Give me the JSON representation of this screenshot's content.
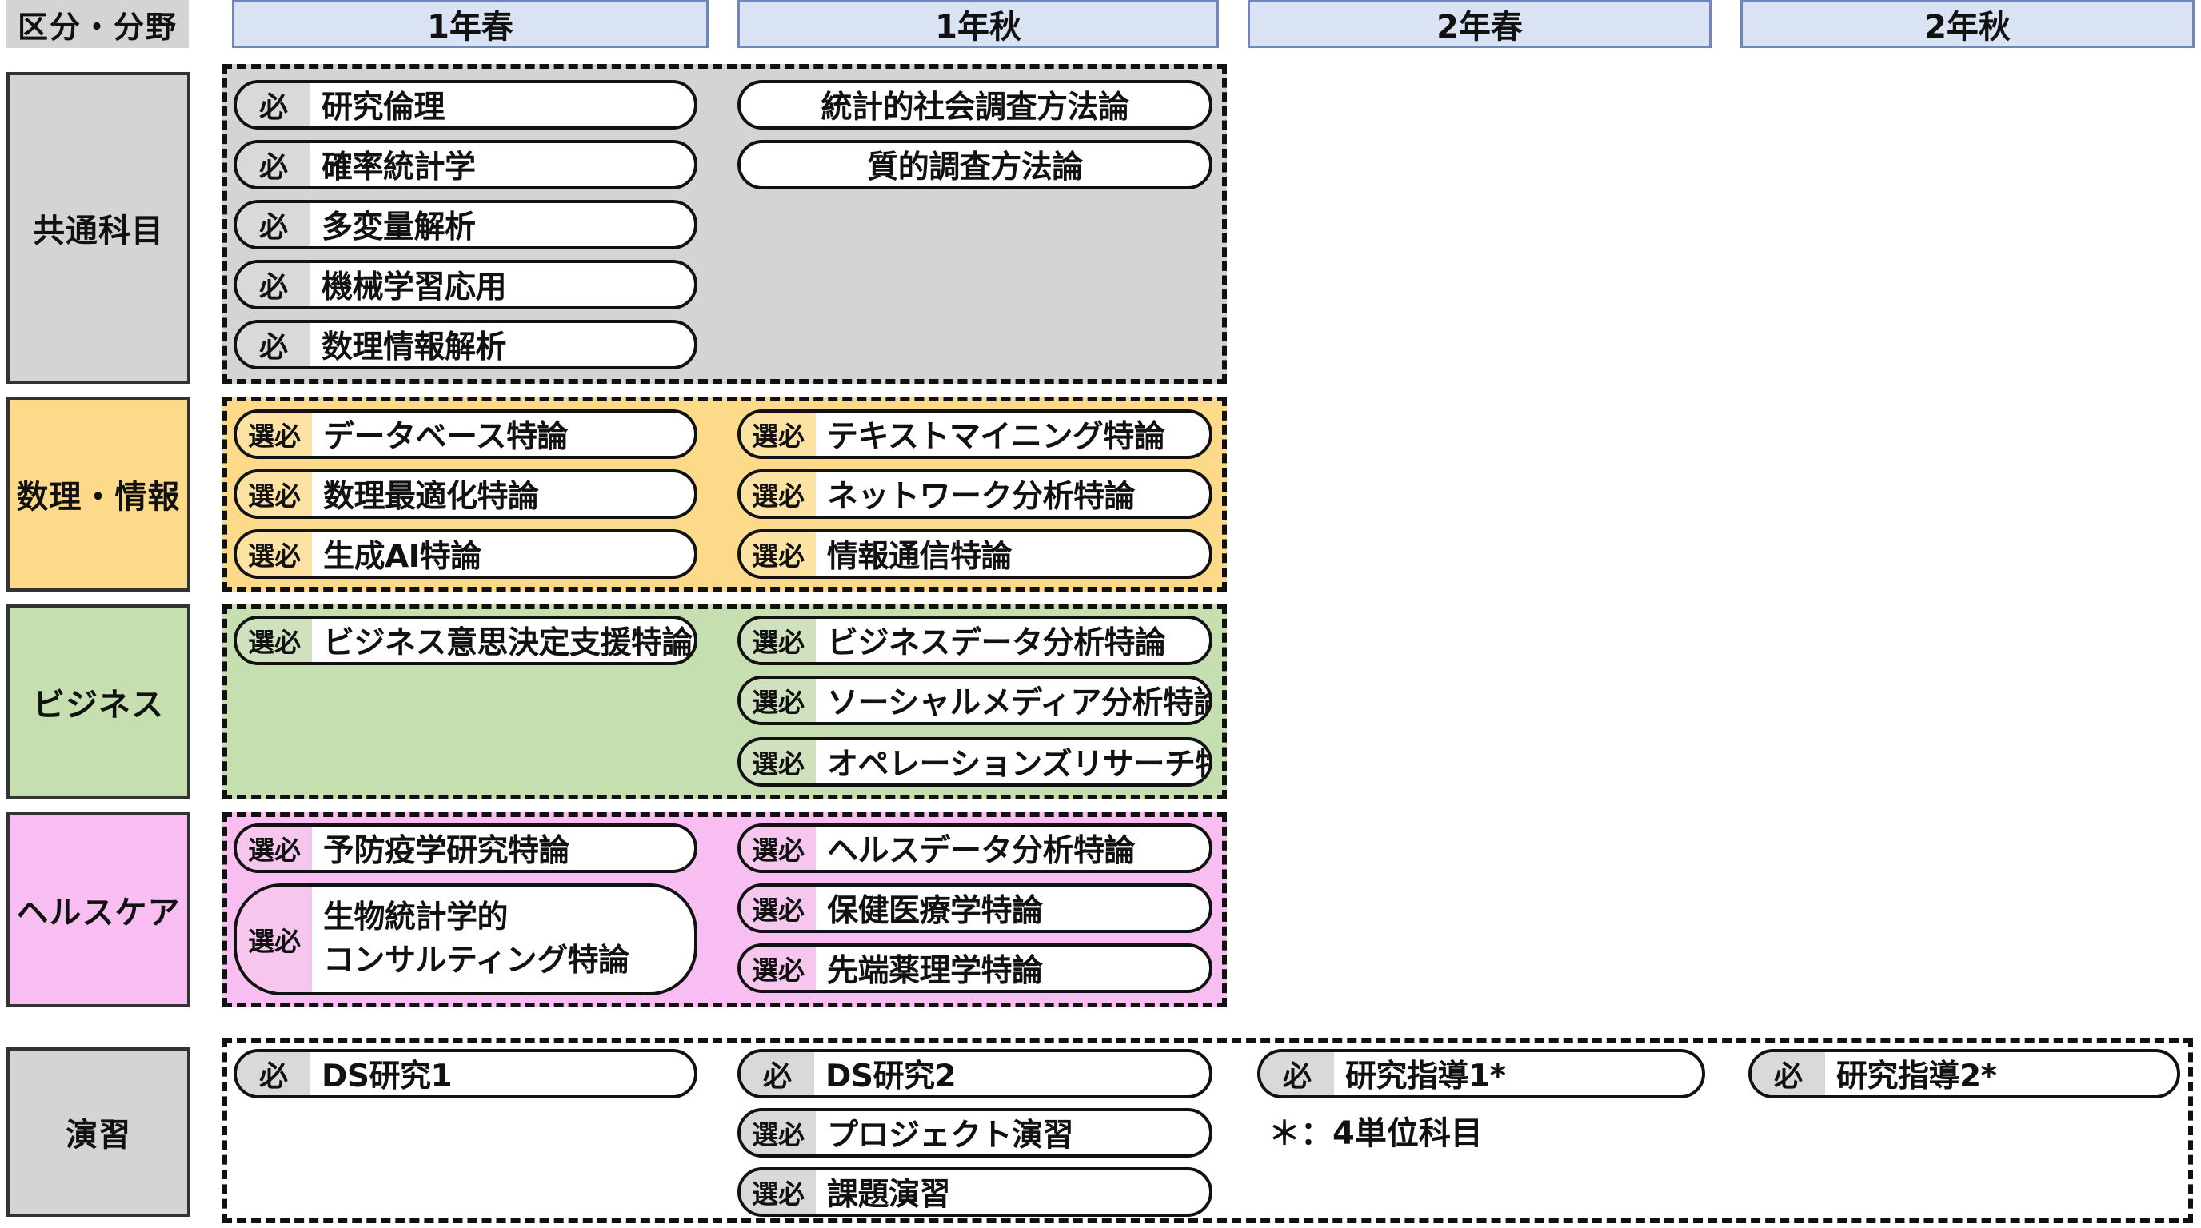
{
  "header": {
    "corner": "区分・分野",
    "columns": [
      "1年春",
      "1年秋",
      "2年春",
      "2年秋"
    ]
  },
  "rows": {
    "common": "共通科目",
    "math": "数理・情報",
    "business": "ビジネス",
    "health": "ヘルスケア",
    "practice": "演習"
  },
  "badges": {
    "required": "必",
    "elective": "選必"
  },
  "colors": {
    "common": "#d4d4d4",
    "math": "#fdd98a",
    "business": "#c6dfb0",
    "health": "#f8bdf1",
    "practice": "#d4d4d4",
    "header": "#dae3f3"
  },
  "courses": {
    "common": {
      "spring1": [
        "研究倫理",
        "確率統計学",
        "多変量解析",
        "機械学習応用",
        "数理情報解析"
      ],
      "autumn1": [
        "統計的社会調査方法論",
        "質的調査方法論"
      ]
    },
    "math": {
      "spring1": [
        "データベース特論",
        "数理最適化特論",
        "生成AI特論"
      ],
      "autumn1": [
        "テキストマイニング特論",
        "ネットワーク分析特論",
        "情報通信特論"
      ]
    },
    "business": {
      "spring1": [
        "ビジネス意思決定支援特論"
      ],
      "autumn1": [
        "ビジネスデータ分析特論",
        "ソーシャルメディア分析特論",
        "オペレーションズリサーチ特論"
      ]
    },
    "health": {
      "spring1": [
        "予防疫学研究特論",
        "生物統計学的",
        "コンサルティング特論"
      ],
      "autumn1": [
        "ヘルスデータ分析特論",
        "保健医療学特論",
        "先端薬理学特論"
      ]
    },
    "practice": {
      "spring1": [
        "DS研究1"
      ],
      "autumn1": [
        "DS研究2",
        "プロジェクト演習",
        "課題演習"
      ],
      "spring2": [
        "研究指導1*"
      ],
      "autumn2": [
        "研究指導2*"
      ]
    }
  },
  "note": "＊：4単位科目"
}
